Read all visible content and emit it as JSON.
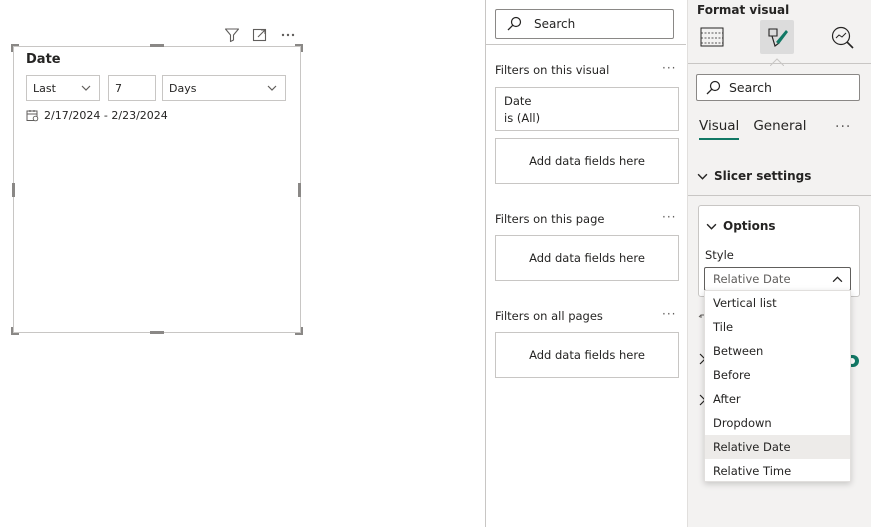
{
  "canvas": {
    "slicer": {
      "title": "Date",
      "range_mode": "Last",
      "range_count": "7",
      "range_unit": "Days",
      "date_range_text": "2/17/2024 - 2/23/2024"
    }
  },
  "filters_pane": {
    "search_placeholder": "Search",
    "on_visual": {
      "label": "Filters on this visual",
      "field_name": "Date",
      "field_state": "is (All)",
      "add_label": "Add data fields here"
    },
    "on_page": {
      "label": "Filters on this page",
      "add_label": "Add data fields here"
    },
    "on_all_pages": {
      "label": "Filters on all pages",
      "add_label": "Add data fields here"
    }
  },
  "format_pane": {
    "title": "Format visual",
    "search_placeholder": "Search",
    "tabs": {
      "visual": "Visual",
      "general": "General"
    },
    "slicer_settings_label": "Slicer settings",
    "options_label": "Options",
    "style_label": "Style",
    "style_value": "Relative Date",
    "style_options": [
      "Vertical list",
      "Tile",
      "Between",
      "Before",
      "After",
      "Dropdown",
      "Relative Date",
      "Relative Time"
    ],
    "selected_index": 6,
    "accent_color": "#117865"
  }
}
